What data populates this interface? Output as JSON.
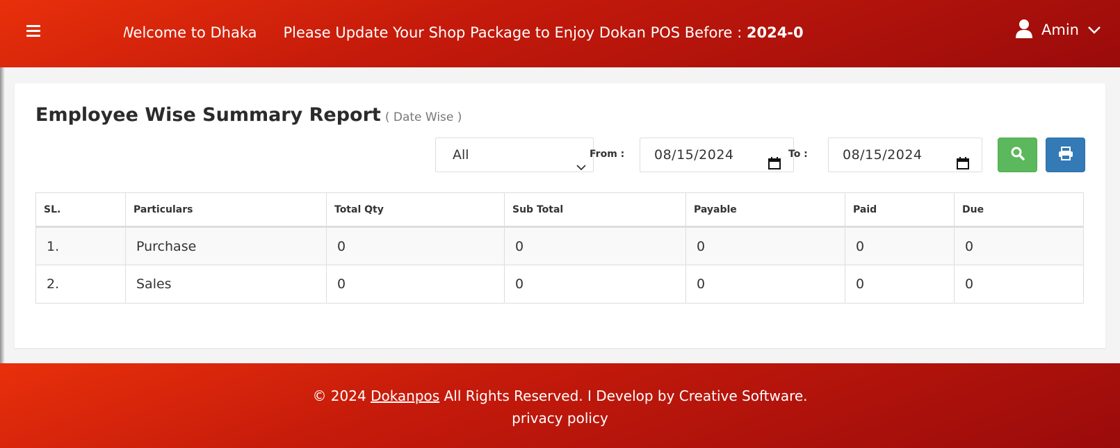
{
  "header": {
    "marquee_welcome": "Welcome to Dhaka",
    "marquee_notice_prefix": "Please Update Your Shop Package to Enjoy Dokan POS Before : ",
    "marquee_notice_date": "2024-0",
    "user_name": "Amin"
  },
  "report": {
    "title": "Employee Wise Summary Report",
    "subtitle": "( Date Wise )",
    "filter_selected": "All",
    "from_label": "From :",
    "from_value": "08/15/2024",
    "to_label": "To :",
    "to_value": "08/15/2024"
  },
  "table": {
    "headers": [
      "SL.",
      "Particulars",
      "Total Qty",
      "Sub Total",
      "Payable",
      "Paid",
      "Due"
    ],
    "rows": [
      {
        "sl": "1.",
        "particulars": "Purchase",
        "total_qty": "0",
        "sub_total": "0",
        "payable": "0",
        "paid": "0",
        "due": "0"
      },
      {
        "sl": "2.",
        "particulars": "Sales",
        "total_qty": "0",
        "sub_total": "0",
        "payable": "0",
        "paid": "0",
        "due": "0"
      }
    ]
  },
  "footer": {
    "copyright": "© 2024",
    "brand_link": "Dokanpos",
    "rights": "All Rights Reserved. I Develop by  Creative Software.",
    "privacy": "privacy policy"
  },
  "colors": {
    "header_red": "#d4200c",
    "search_green": "#5cb85c",
    "print_blue": "#337ab7"
  },
  "icons": {
    "menu": "bars-icon",
    "user": "user-icon",
    "dropdown": "chevron-down-icon",
    "calendar": "calendar-icon",
    "search": "search-icon",
    "print": "print-icon"
  }
}
